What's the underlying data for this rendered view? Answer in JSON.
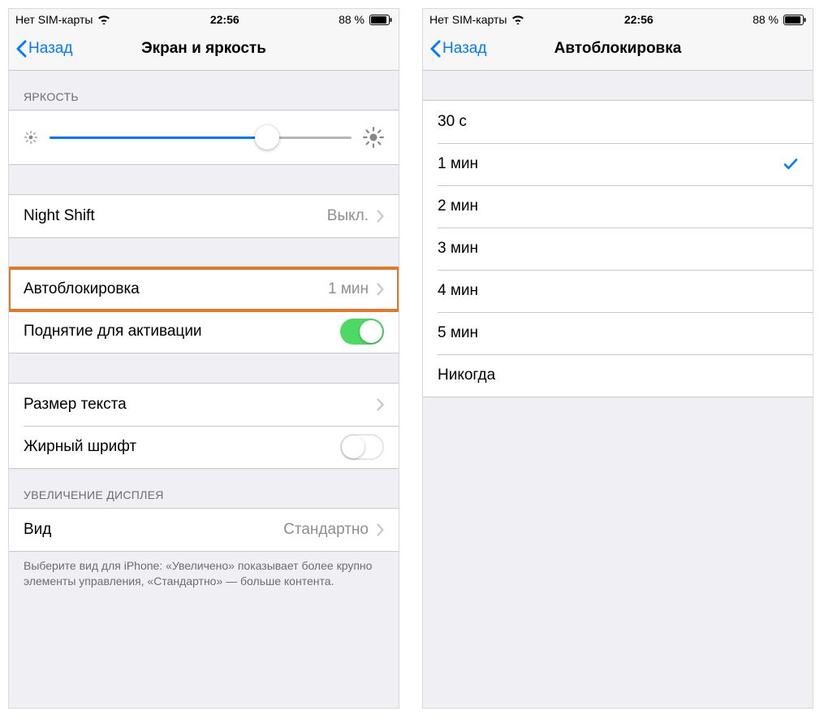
{
  "status": {
    "carrier": "Нет SIM-карты",
    "time": "22:56",
    "battery_pct": "88 %"
  },
  "screen_left": {
    "back_label": "Назад",
    "title": "Экран и яркость",
    "brightness": {
      "header": "ЯРКОСТЬ",
      "slider_pct": 72
    },
    "night_shift": {
      "label": "Night Shift",
      "value": "Выкл."
    },
    "autolock": {
      "label": "Автоблокировка",
      "value": "1 мин"
    },
    "raise_to_wake": {
      "label": "Поднятие для активации",
      "on": true
    },
    "text_size": {
      "label": "Размер текста"
    },
    "bold_text": {
      "label": "Жирный шрифт",
      "on": false
    },
    "display_zoom": {
      "header": "УВЕЛИЧЕНИЕ ДИСПЛЕЯ",
      "view_label": "Вид",
      "view_value": "Стандартно",
      "footer": "Выберите вид для iPhone: «Увеличено» показывает более крупно элементы управления, «Стандартно» — больше контента."
    }
  },
  "screen_right": {
    "back_label": "Назад",
    "title": "Автоблокировка",
    "options": [
      {
        "label": "30 с",
        "selected": false
      },
      {
        "label": "1 мин",
        "selected": true
      },
      {
        "label": "2 мин",
        "selected": false
      },
      {
        "label": "3 мин",
        "selected": false
      },
      {
        "label": "4 мин",
        "selected": false
      },
      {
        "label": "5 мин",
        "selected": false
      },
      {
        "label": "Никогда",
        "selected": false
      }
    ]
  }
}
